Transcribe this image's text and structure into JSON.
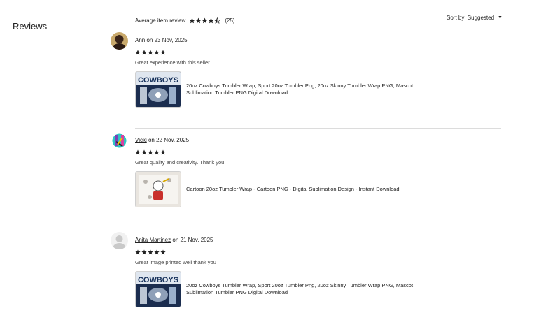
{
  "header": {
    "title": "Reviews",
    "average_label": "Average item review",
    "average_rating": 4.5,
    "review_count": "(25)",
    "sort_label": "Sort by: Suggested"
  },
  "colors": {
    "star": "#222222",
    "divider": "#dcdcdc",
    "text": "#222222"
  },
  "reviews": [
    {
      "author": "Ann",
      "date": "on 23 Nov, 2025",
      "rating": 5,
      "comment": "Great experience with this seller.",
      "item_title": "20oz Cowboys Tumbler Wrap, Sport 20oz Tumbler Png, 20oz Skinny Tumbler Wrap PNG, Mascot Sublimation Tumbler PNG Digital Download",
      "thumb_text": "COWBOYS"
    },
    {
      "author": "Vicki",
      "date": "on 22 Nov, 2025",
      "rating": 5,
      "comment": "Great quality and creativity. Thank you",
      "item_title": "Cartoon 20oz Tumbler Wrap - Cartoon PNG - Digital Sublimation Design - Instant Download",
      "thumb_text": ""
    },
    {
      "author": "Anita Martinez",
      "date": "on 21 Nov, 2025",
      "rating": 5,
      "comment": "Great image printed well thank you",
      "item_title": "20oz Cowboys Tumbler Wrap, Sport 20oz Tumbler Png, 20oz Skinny Tumbler Wrap PNG, Mascot Sublimation Tumbler PNG Digital Download",
      "thumb_text": "COWBOYS"
    }
  ]
}
